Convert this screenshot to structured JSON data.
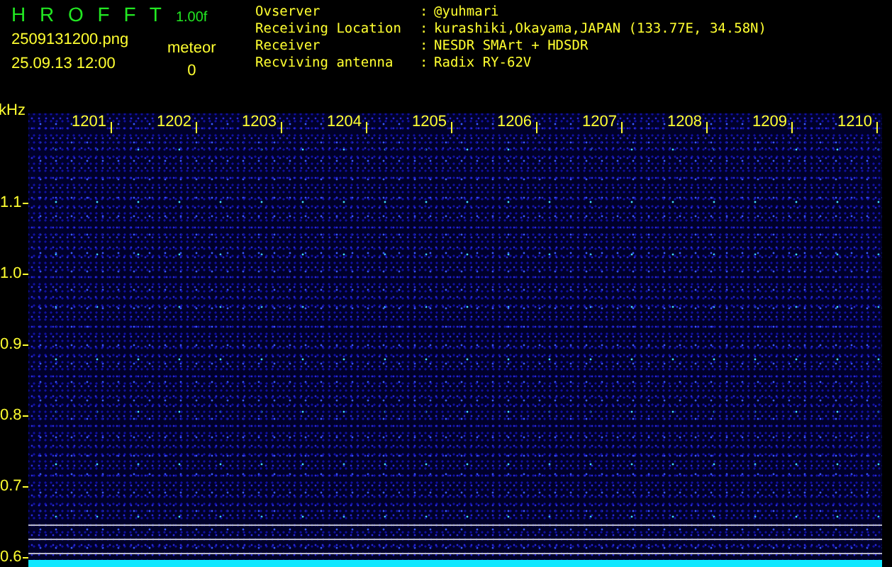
{
  "app": {
    "title": "H R O F F T",
    "version": "1.00f"
  },
  "file": {
    "name": "2509131200.png",
    "datetime": "25.09.13 12:00"
  },
  "counter": {
    "label": "meteor",
    "value": "0"
  },
  "info": [
    {
      "label": "Ovserver",
      "separator": ":",
      "value": "@yuhmari"
    },
    {
      "label": "Receiving Location",
      "separator": ":",
      "value": "kurashiki,Okayama,JAPAN (133.77E, 34.58N)"
    },
    {
      "label": "Receiver",
      "separator": ":",
      "value": "NESDR SMArt + HDSDR"
    },
    {
      "label": "Recviving antenna",
      "separator": ":",
      "value": "Radix RY-62V"
    }
  ],
  "plot": {
    "y_unit": "kHz",
    "x_labels": [
      "1201",
      "1202",
      "1203",
      "1204",
      "1205",
      "1206",
      "1207",
      "1208",
      "1209",
      "1210"
    ],
    "y_labels": [
      "1.1",
      "1.0",
      "0.9",
      "0.8",
      "0.7",
      "0.6"
    ]
  }
}
